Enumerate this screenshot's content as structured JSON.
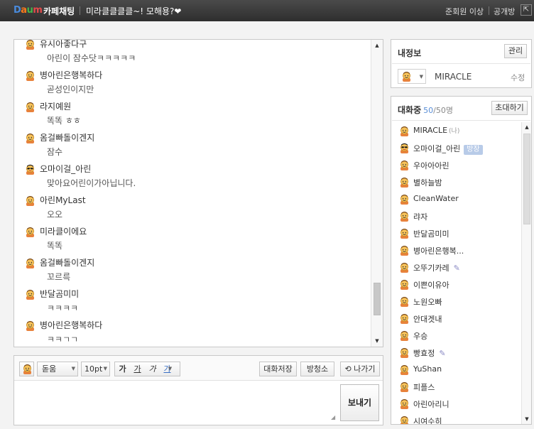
{
  "header": {
    "logo": [
      "D",
      "a",
      "u",
      "m"
    ],
    "app_name": "카페채팅",
    "room_title": "미라클클클클~! 모해용?❤",
    "grade": "준회원 이상",
    "openness": "공개방"
  },
  "chat": {
    "messages": [
      {
        "nick": "유시아좋다구",
        "text": "아린이 잠수닷ㅋㅋㅋㅋㅋ",
        "avatar": "smile-face-icon"
      },
      {
        "nick": "병아린은행복하다",
        "text": "곧성인이지만",
        "avatar": "smile-face-icon"
      },
      {
        "nick": "라지예원",
        "text": "똑똑 ㅎㅎ",
        "avatar": "smile-face-icon"
      },
      {
        "nick": "옴걸빠돌이겐지",
        "text": "잠수",
        "avatar": "smile-face-icon"
      },
      {
        "nick": "오마이걸_아린",
        "text": "맞아요어린이가아닙니다.",
        "avatar": "sunglasses-face-icon"
      },
      {
        "nick": "아린MyLast",
        "text": "오오",
        "avatar": "smile-face-icon"
      },
      {
        "nick": "미라클이에요",
        "text": "똑똑",
        "avatar": "smile-face-icon"
      },
      {
        "nick": "옴걸빠돌이겐지",
        "text": "꼬르륵",
        "avatar": "smile-face-icon"
      },
      {
        "nick": "반달곰미미",
        "text": "ㅋㅋㅋㅋ",
        "avatar": "smile-face-icon"
      },
      {
        "nick": "병아린은행복하다",
        "text": "ㅋㅋㄱㄱ",
        "avatar": "smile-face-icon"
      }
    ],
    "scroll_position": 0.92
  },
  "compose": {
    "emoticon_icon": "smile-face-icon",
    "font": "돋움",
    "font_size": "10pt",
    "styles": [
      "가",
      "가",
      "가",
      "가"
    ],
    "save_label": "대화저장",
    "clear_label": "방청소",
    "exit_label": "나가기",
    "send_label": "보내기",
    "message_value": ""
  },
  "myinfo": {
    "title": "내정보",
    "manage_label": "관리",
    "nickname": "MIRACLE",
    "edit_label": "수정"
  },
  "members": {
    "title": "대화중",
    "count": "50",
    "total": "/50명",
    "invite_label": "초대하기",
    "me_tag": "(나)",
    "host_badge": "방장",
    "list": [
      {
        "name": "MIRACLE",
        "me": true,
        "avatar": "smile-face-icon"
      },
      {
        "name": "오마이걸_아린",
        "host": true,
        "avatar": "sunglasses-face-icon"
      },
      {
        "name": "우아아아린",
        "avatar": "smile-face-icon"
      },
      {
        "name": "별하늘밤",
        "avatar": "smile-face-icon"
      },
      {
        "name": "CleanWater",
        "avatar": "smile-face-icon"
      },
      {
        "name": "랴자",
        "avatar": "smile-face-icon"
      },
      {
        "name": "반달곰미미",
        "avatar": "smile-face-icon"
      },
      {
        "name": "병아린은행복...",
        "avatar": "smile-face-icon"
      },
      {
        "name": "오뚜기카레",
        "pencil": true,
        "avatar": "smile-face-icon"
      },
      {
        "name": "이쁜이유아",
        "avatar": "smile-face-icon"
      },
      {
        "name": "노원오빠",
        "avatar": "smile-face-icon"
      },
      {
        "name": "안대겟내",
        "avatar": "smile-face-icon"
      },
      {
        "name": "우승",
        "avatar": "smile-face-icon"
      },
      {
        "name": "빵효정",
        "pencil": true,
        "avatar": "smile-face-icon"
      },
      {
        "name": "YuShan",
        "avatar": "smile-face-icon"
      },
      {
        "name": "피플스",
        "avatar": "smile-face-icon"
      },
      {
        "name": "아린아리니",
        "avatar": "smile-face-icon"
      },
      {
        "name": "시여수히",
        "avatar": "smile-face-icon"
      }
    ]
  },
  "colors": {
    "topbar": "#3a3a3a",
    "accent": "#5b8fd6",
    "host_badge": "#b8cbe8",
    "avatar_face": "#f7c35a",
    "avatar_shirt": "#e8823c"
  }
}
